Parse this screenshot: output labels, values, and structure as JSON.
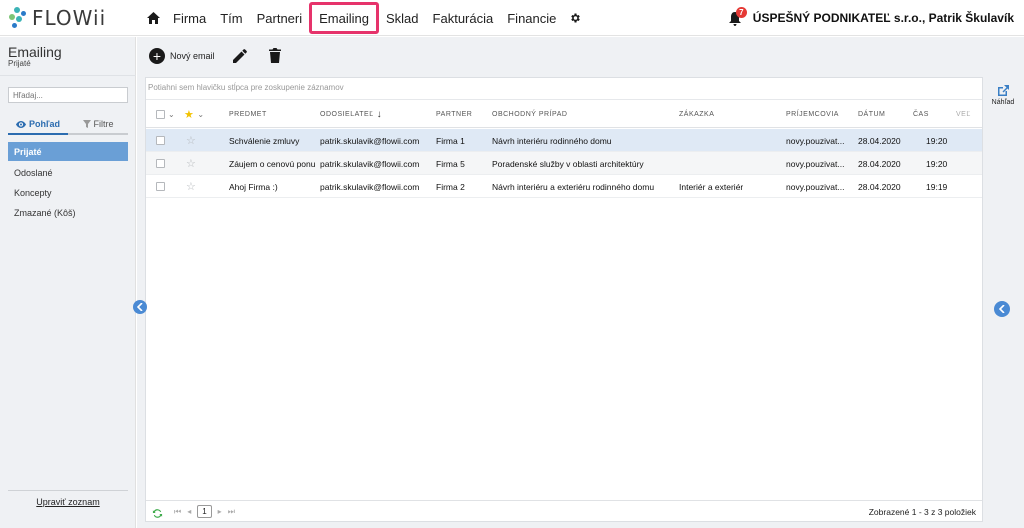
{
  "brand": {
    "name": "FLOWii",
    "colors": {
      "teal": "#3bb3b6",
      "blue": "#2b7bc9",
      "green": "#7cc576"
    }
  },
  "nav": {
    "home_icon": "home-icon",
    "items": [
      {
        "label": "Firma"
      },
      {
        "label": "Tím"
      },
      {
        "label": "Partneri"
      },
      {
        "label": "Emailing"
      },
      {
        "label": "Sklad"
      },
      {
        "label": "Fakturácia"
      },
      {
        "label": "Financie"
      }
    ],
    "active": "Emailing",
    "highlight_color": "#e6336b",
    "gear_icon": "gear-icon"
  },
  "header": {
    "notification_count": "7",
    "company": "ÚSPEŠNÝ PODNIKATEĽ s.r.o., Patrik Škulavík"
  },
  "sidebar": {
    "title": "Emailing",
    "subtitle": "Prijaté",
    "search_placeholder": "Hľadaj...",
    "tabs": [
      {
        "label": "Pohľad"
      },
      {
        "label": "Filtre"
      }
    ],
    "items": [
      {
        "label": "Prijaté"
      },
      {
        "label": "Odoslané"
      },
      {
        "label": "Koncepty"
      },
      {
        "label": "Zmazané (Kôš)"
      }
    ],
    "manage_label": "Upraviť zoznam"
  },
  "toolbar": {
    "new_label": "Nový email",
    "preview_label": "Náhľad"
  },
  "grid": {
    "group_hint": "Potiahni sem hlavičku stĺpca pre zoskupenie záznamov",
    "columns": {
      "subject": "PREDMET",
      "sender": "ODOSIELATEĽ",
      "partner": "PARTNER",
      "case": "OBCHODNÝ PRÍPAD",
      "order": "ZÁKAZKA",
      "recipients": "PRÍJEMCOVIA",
      "date": "DÁTUM",
      "time": "ČAS",
      "more": "VEĽ"
    },
    "rows": [
      {
        "subject": "Schválenie zmluvy",
        "sender": "patrik.skulavik@flowii.com",
        "partner": "Firma 1",
        "case": "Návrh interiéru rodinného domu",
        "order": "",
        "recipients": "novy.pouzivat...",
        "date": "28.04.2020",
        "time": "19:20"
      },
      {
        "subject": "Záujem o cenovú ponu",
        "sender": "patrik.skulavik@flowii.com",
        "partner": "Firma 5",
        "case": "Poradenské služby v oblasti architektúry",
        "order": "",
        "recipients": "novy.pouzivat...",
        "date": "28.04.2020",
        "time": "19:20"
      },
      {
        "subject": "Ahoj Firma :)",
        "sender": "patrik.skulavik@flowii.com",
        "partner": "Firma 2",
        "case": "Návrh interiéru a exteriéru rodinného domu",
        "order": "Interiér a exteriér",
        "recipients": "novy.pouzivat...",
        "date": "28.04.2020",
        "time": "19:19"
      }
    ],
    "pager": {
      "page": "1"
    },
    "count_text": "Zobrazené 1 - 3 z 3 položiek"
  }
}
